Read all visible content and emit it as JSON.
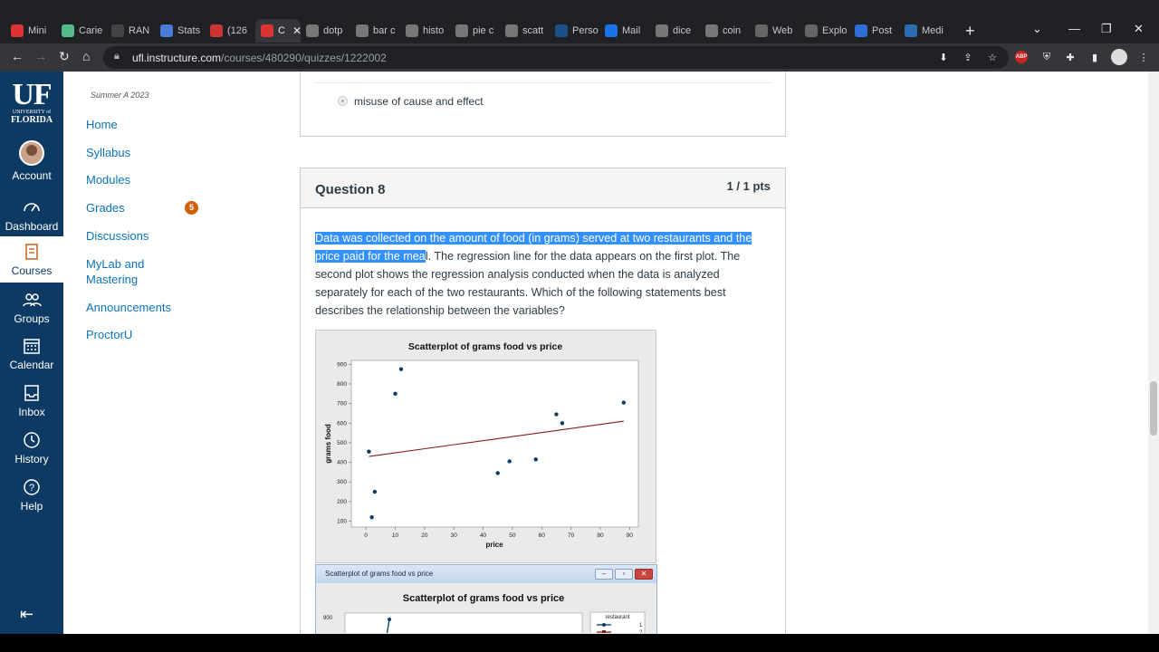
{
  "browser": {
    "tabs": [
      {
        "label": "Mini",
        "icon": "canvas-icon",
        "color": "#d33"
      },
      {
        "label": "Carie",
        "icon": "page-icon",
        "color": "#5b8"
      },
      {
        "label": "RAN",
        "icon": "r-icon",
        "color": "#444"
      },
      {
        "label": "Stats",
        "icon": "docs-icon",
        "color": "#4a7bd8"
      },
      {
        "label": "(126",
        "icon": "badge-icon",
        "color": "#c33"
      },
      {
        "label": "C",
        "icon": "canvas-icon",
        "color": "#d33"
      },
      {
        "label": "dotp",
        "icon": "google-icon",
        "color": "#777"
      },
      {
        "label": "bar c",
        "icon": "google-icon",
        "color": "#777"
      },
      {
        "label": "histo",
        "icon": "google-icon",
        "color": "#777"
      },
      {
        "label": "pie c",
        "icon": "google-icon",
        "color": "#777"
      },
      {
        "label": "scatt",
        "icon": "google-icon",
        "color": "#777"
      },
      {
        "label": "Perso",
        "icon": "uf-icon",
        "color": "#1b4f8a"
      },
      {
        "label": "Mail",
        "icon": "outlook-icon",
        "color": "#1a73e8"
      },
      {
        "label": "dice",
        "icon": "google-icon",
        "color": "#777"
      },
      {
        "label": "coin",
        "icon": "google-icon",
        "color": "#777"
      },
      {
        "label": "Web",
        "icon": "globe-icon",
        "color": "#666"
      },
      {
        "label": "Explo",
        "icon": "globe-icon",
        "color": "#666"
      },
      {
        "label": "Post",
        "icon": "z-icon",
        "color": "#2d6fd6"
      },
      {
        "label": "Medi",
        "icon": "grid-icon",
        "color": "#2f6bb3"
      }
    ],
    "url_domain": "ufl.instructure.com",
    "url_path": "/courses/480290/quizzes/1222002"
  },
  "global_nav": {
    "logo_main": "UF",
    "logo_sub": "UNIVERSITY of",
    "logo_sub2": "FLORIDA",
    "items": [
      {
        "label": "Account",
        "icon": "avatar"
      },
      {
        "label": "Dashboard",
        "icon": "dashboard-icon"
      },
      {
        "label": "Courses",
        "icon": "courses-icon"
      },
      {
        "label": "Groups",
        "icon": "groups-icon"
      },
      {
        "label": "Calendar",
        "icon": "calendar-icon"
      },
      {
        "label": "Inbox",
        "icon": "inbox-icon"
      },
      {
        "label": "History",
        "icon": "history-icon"
      },
      {
        "label": "Help",
        "icon": "help-icon"
      }
    ]
  },
  "course_nav": {
    "term": "Summer A 2023",
    "items": [
      "Home",
      "Syllabus",
      "Modules",
      "Grades",
      "Discussions",
      "MyLab and Mastering",
      "Announcements",
      "ProctorU"
    ],
    "grades_badge": "5"
  },
  "previous_question": {
    "option": "misuse of cause and effect"
  },
  "question": {
    "title": "Question 8",
    "points": "1 / 1 pts",
    "text_highlighted": "Data was collected on the amount of food (in grams) served at two restaurants and the price paid for the mea",
    "text_rest": "l. The regression line for the data appears on the first plot. The second plot shows the regression analysis conducted when the data is analyzed separately for each of the two restaurants. Which of the following statements best describes the relationship between the variables?"
  },
  "plot2": {
    "window_title": "Scatterplot of grams food vs price",
    "heading": "Scatterplot of grams food vs price"
  },
  "chart_data": {
    "type": "scatter",
    "title": "Scatterplot of grams food vs price",
    "xlabel": "price",
    "ylabel": "grams food",
    "xlim": [
      -5,
      93
    ],
    "ylim": [
      70,
      920
    ],
    "x_ticks": [
      0,
      10,
      20,
      30,
      40,
      50,
      60,
      70,
      80,
      90
    ],
    "y_ticks": [
      100,
      200,
      300,
      400,
      500,
      600,
      700,
      800,
      900
    ],
    "grid": false,
    "points": [
      {
        "x": 1,
        "y": 455
      },
      {
        "x": 2,
        "y": 120
      },
      {
        "x": 3,
        "y": 250
      },
      {
        "x": 10,
        "y": 750
      },
      {
        "x": 12,
        "y": 875
      },
      {
        "x": 45,
        "y": 345
      },
      {
        "x": 49,
        "y": 405
      },
      {
        "x": 58,
        "y": 415
      },
      {
        "x": 65,
        "y": 645
      },
      {
        "x": 67,
        "y": 600
      },
      {
        "x": 88,
        "y": 705
      }
    ],
    "regression_line": {
      "x": [
        1,
        88
      ],
      "y": [
        430,
        610
      ]
    },
    "colors": {
      "points": "#0e3a66",
      "line": "#8b1a1a"
    }
  }
}
